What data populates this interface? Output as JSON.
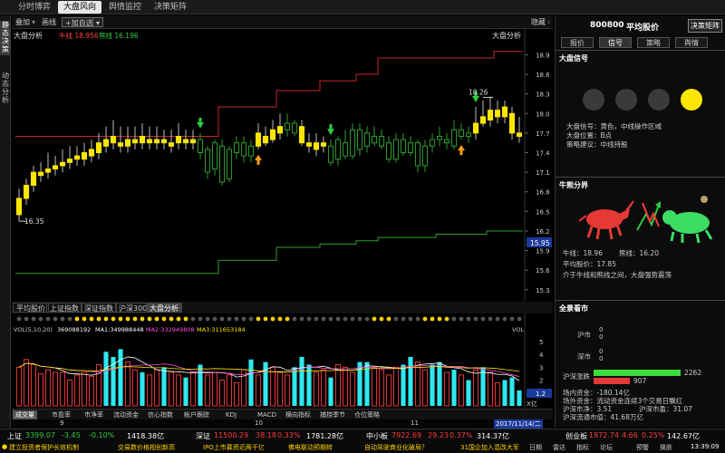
{
  "topnav": {
    "tabs": [
      "分时博弈",
      "大盘风向",
      "舆情监控",
      "决策矩阵"
    ],
    "active": 1
  },
  "leftbar": {
    "items": [
      "静态决策",
      "动态分析"
    ]
  },
  "toolbar": {
    "overlay": "叠加",
    "curve": "画线",
    "add": "+加自选"
  },
  "chart": {
    "label_left": "大盘分析",
    "bull_label": "牛线 18.956",
    "bear_label": "熊线 16.196",
    "label_right": "大盘分析",
    "y_ticks": [
      "18.9",
      "18.6",
      "18.3",
      "18.0",
      "17.7",
      "17.4",
      "17.1",
      "16.8",
      "16.5",
      "16.2",
      "15.9",
      "15.6",
      "15.3"
    ],
    "current_price_tag": "15.95",
    "high_annot": "18.26",
    "low_annot": "16.35",
    "colors": {
      "bull_line": "#c62828",
      "bear_line": "#2e9e2e",
      "up_candle": "#ffe600",
      "down_candle": "#2e9e2e"
    }
  },
  "chart_data": {
    "type": "candlestick",
    "ylim": [
      15.2,
      19.1
    ],
    "candles": [
      {
        "o": 16.45,
        "c": 16.7,
        "h": 16.85,
        "l": 16.35,
        "up": true
      },
      {
        "o": 16.7,
        "c": 16.9,
        "h": 17.0,
        "l": 16.6,
        "up": true
      },
      {
        "o": 16.9,
        "c": 17.1,
        "h": 17.2,
        "l": 16.8,
        "up": true
      },
      {
        "o": 17.05,
        "c": 17.1,
        "h": 17.25,
        "l": 16.95,
        "up": true
      },
      {
        "o": 17.1,
        "c": 17.15,
        "h": 17.4,
        "l": 17.0,
        "up": true
      },
      {
        "o": 17.15,
        "c": 17.2,
        "h": 17.35,
        "l": 17.05,
        "up": true
      },
      {
        "o": 17.2,
        "c": 17.25,
        "h": 17.45,
        "l": 17.1,
        "up": true
      },
      {
        "o": 17.25,
        "c": 17.3,
        "h": 17.5,
        "l": 17.15,
        "up": true
      },
      {
        "o": 17.3,
        "c": 17.35,
        "h": 17.5,
        "l": 17.2,
        "up": true
      },
      {
        "o": 17.3,
        "c": 17.4,
        "h": 17.55,
        "l": 17.2,
        "up": true
      },
      {
        "o": 17.35,
        "c": 17.45,
        "h": 17.6,
        "l": 17.25,
        "up": true
      },
      {
        "o": 17.4,
        "c": 17.55,
        "h": 17.7,
        "l": 17.3,
        "up": true
      },
      {
        "o": 17.5,
        "c": 17.6,
        "h": 17.8,
        "l": 17.4,
        "up": true
      },
      {
        "o": 17.55,
        "c": 17.65,
        "h": 17.9,
        "l": 17.45,
        "up": true
      },
      {
        "o": 17.55,
        "c": 17.5,
        "h": 17.8,
        "l": 17.4,
        "up": true
      },
      {
        "o": 17.5,
        "c": 17.6,
        "h": 17.8,
        "l": 17.4,
        "up": true
      },
      {
        "o": 17.6,
        "c": 17.55,
        "h": 17.8,
        "l": 17.45,
        "up": true
      },
      {
        "o": 17.55,
        "c": 17.65,
        "h": 17.85,
        "l": 17.45,
        "up": true
      },
      {
        "o": 17.6,
        "c": 17.55,
        "h": 17.8,
        "l": 17.45,
        "up": true
      },
      {
        "o": 17.55,
        "c": 17.6,
        "h": 17.8,
        "l": 17.45,
        "up": true
      },
      {
        "o": 17.55,
        "c": 17.6,
        "h": 17.75,
        "l": 17.45,
        "up": true
      },
      {
        "o": 17.5,
        "c": 17.55,
        "h": 17.75,
        "l": 17.4,
        "up": true
      },
      {
        "o": 17.55,
        "c": 17.65,
        "h": 17.85,
        "l": 17.45,
        "up": true
      },
      {
        "o": 17.6,
        "c": 17.55,
        "h": 17.75,
        "l": 17.45,
        "up": true
      },
      {
        "o": 17.55,
        "c": 17.6,
        "h": 17.75,
        "l": 17.45,
        "up": true
      },
      {
        "o": 17.6,
        "c": 17.4,
        "h": 17.7,
        "l": 17.3,
        "up": false
      },
      {
        "o": 17.45,
        "c": 17.1,
        "h": 17.5,
        "l": 17.0,
        "up": false
      },
      {
        "o": 17.15,
        "c": 17.55,
        "h": 17.6,
        "l": 17.05,
        "up": false
      },
      {
        "o": 17.5,
        "c": 16.95,
        "h": 17.6,
        "l": 16.9,
        "up": false
      },
      {
        "o": 17.0,
        "c": 17.45,
        "h": 17.5,
        "l": 16.95,
        "up": false
      },
      {
        "o": 17.4,
        "c": 17.55,
        "h": 17.65,
        "l": 17.3,
        "up": false
      },
      {
        "o": 17.55,
        "c": 17.35,
        "h": 17.65,
        "l": 17.25,
        "up": false
      },
      {
        "o": 17.35,
        "c": 17.5,
        "h": 17.6,
        "l": 17.25,
        "up": false
      },
      {
        "o": 17.5,
        "c": 17.7,
        "h": 17.85,
        "l": 17.45,
        "up": true
      },
      {
        "o": 17.65,
        "c": 17.55,
        "h": 17.8,
        "l": 17.5,
        "up": true
      },
      {
        "o": 17.6,
        "c": 17.75,
        "h": 17.9,
        "l": 17.55,
        "up": true
      },
      {
        "o": 17.7,
        "c": 17.8,
        "h": 18.0,
        "l": 17.6,
        "up": true
      },
      {
        "o": 17.75,
        "c": 17.85,
        "h": 18.0,
        "l": 17.65,
        "up": false
      },
      {
        "o": 17.85,
        "c": 17.7,
        "h": 17.9,
        "l": 17.65,
        "up": false
      },
      {
        "o": 17.8,
        "c": 17.55,
        "h": 17.9,
        "l": 17.5,
        "up": true
      },
      {
        "o": 17.55,
        "c": 17.5,
        "h": 17.7,
        "l": 17.4,
        "up": true
      },
      {
        "o": 17.55,
        "c": 17.45,
        "h": 17.7,
        "l": 17.35,
        "up": true
      },
      {
        "o": 17.5,
        "c": 17.55,
        "h": 17.65,
        "l": 17.4,
        "up": true
      },
      {
        "o": 17.5,
        "c": 17.25,
        "h": 17.6,
        "l": 17.2,
        "up": false
      },
      {
        "o": 17.3,
        "c": 17.6,
        "h": 17.65,
        "l": 17.2,
        "up": false
      },
      {
        "o": 17.55,
        "c": 17.35,
        "h": 17.75,
        "l": 17.3,
        "up": false
      },
      {
        "o": 17.35,
        "c": 17.75,
        "h": 17.85,
        "l": 17.3,
        "up": false
      },
      {
        "o": 17.75,
        "c": 17.45,
        "h": 17.85,
        "l": 17.35,
        "up": false
      },
      {
        "o": 17.5,
        "c": 17.7,
        "h": 17.8,
        "l": 17.4,
        "up": false
      },
      {
        "o": 17.65,
        "c": 17.55,
        "h": 17.8,
        "l": 17.5,
        "up": false
      },
      {
        "o": 17.5,
        "c": 17.65,
        "h": 17.75,
        "l": 17.45,
        "up": false
      },
      {
        "o": 17.55,
        "c": 17.3,
        "h": 17.65,
        "l": 17.25,
        "up": false
      },
      {
        "o": 17.3,
        "c": 17.6,
        "h": 17.7,
        "l": 17.25,
        "up": false
      },
      {
        "o": 17.6,
        "c": 17.4,
        "h": 17.7,
        "l": 17.35,
        "up": false
      },
      {
        "o": 17.4,
        "c": 17.55,
        "h": 17.65,
        "l": 17.35,
        "up": false
      },
      {
        "o": 17.55,
        "c": 17.2,
        "h": 17.6,
        "l": 17.1,
        "up": false
      },
      {
        "o": 17.2,
        "c": 17.5,
        "h": 17.6,
        "l": 17.1,
        "up": false
      },
      {
        "o": 17.5,
        "c": 17.6,
        "h": 17.7,
        "l": 17.4,
        "up": false
      },
      {
        "o": 17.6,
        "c": 17.65,
        "h": 17.8,
        "l": 17.5,
        "up": false
      },
      {
        "o": 17.6,
        "c": 17.55,
        "h": 17.7,
        "l": 17.45,
        "up": false
      },
      {
        "o": 17.5,
        "c": 17.75,
        "h": 17.9,
        "l": 17.45,
        "up": false
      },
      {
        "o": 17.75,
        "c": 17.65,
        "h": 17.85,
        "l": 17.6,
        "up": false
      },
      {
        "o": 17.65,
        "c": 17.7,
        "h": 17.8,
        "l": 17.55,
        "up": false
      },
      {
        "o": 17.7,
        "c": 17.85,
        "h": 18.1,
        "l": 17.6,
        "up": true
      },
      {
        "o": 17.85,
        "c": 17.95,
        "h": 18.2,
        "l": 17.8,
        "up": true
      },
      {
        "o": 17.9,
        "c": 18.05,
        "h": 18.26,
        "l": 17.8,
        "up": true
      },
      {
        "o": 18.05,
        "c": 17.95,
        "h": 18.2,
        "l": 17.85,
        "up": true
      },
      {
        "o": 17.95,
        "c": 18.1,
        "h": 18.2,
        "l": 17.85,
        "up": true
      },
      {
        "o": 18.0,
        "c": 17.7,
        "h": 18.1,
        "l": 17.6,
        "up": true
      },
      {
        "o": 17.7,
        "c": 17.65,
        "h": 17.95,
        "l": 17.55,
        "up": true
      }
    ],
    "bull_line": [
      17.65,
      17.65,
      17.65,
      17.65,
      17.65,
      17.65,
      17.65,
      17.65,
      17.65,
      17.65,
      17.65,
      17.65,
      17.65,
      17.65,
      17.65,
      17.65,
      17.65,
      17.65,
      17.65,
      17.65,
      17.65,
      17.65,
      17.65,
      17.65,
      17.65,
      17.65,
      17.65,
      17.65,
      18.1,
      18.1,
      18.1,
      18.1,
      18.1,
      18.1,
      18.1,
      18.1,
      18.35,
      18.35,
      18.35,
      18.35,
      18.35,
      18.35,
      18.5,
      18.5,
      18.5,
      18.5,
      18.5,
      18.6,
      18.6,
      18.6,
      18.85,
      18.85,
      18.85,
      18.85,
      18.85,
      18.85,
      18.85,
      18.85,
      18.85,
      18.85,
      18.85,
      18.85,
      18.85,
      18.85,
      18.85,
      18.85,
      18.95,
      18.95,
      18.95,
      18.95
    ],
    "bear_line": [
      15.55,
      15.55,
      15.55,
      15.55,
      15.55,
      15.55,
      15.55,
      15.55,
      15.55,
      15.55,
      15.55,
      15.55,
      15.55,
      15.55,
      15.55,
      15.55,
      15.55,
      15.55,
      15.55,
      15.55,
      15.55,
      15.55,
      15.55,
      15.55,
      15.55,
      15.55,
      15.55,
      15.55,
      15.75,
      15.75,
      15.75,
      15.75,
      15.75,
      15.75,
      15.75,
      15.75,
      15.95,
      15.95,
      15.95,
      15.95,
      15.95,
      15.95,
      16.0,
      16.0,
      16.0,
      16.0,
      16.0,
      16.05,
      16.05,
      16.05,
      16.1,
      16.1,
      16.1,
      16.1,
      16.1,
      16.1,
      16.1,
      16.1,
      16.15,
      16.15,
      16.15,
      16.15,
      16.15,
      16.15,
      16.15,
      16.2,
      16.2,
      16.2,
      16.2,
      16.2
    ],
    "signals": [
      {
        "i": 25,
        "type": "down"
      },
      {
        "i": 33,
        "type": "up"
      },
      {
        "i": 43,
        "type": "down"
      },
      {
        "i": 61,
        "type": "up"
      },
      {
        "i": 63,
        "type": "down"
      }
    ]
  },
  "subtabs": [
    "平均股价",
    "上证指数",
    "深证指数",
    "沪深300",
    "大盘分析"
  ],
  "subtab_active": 4,
  "vol": {
    "label": "VOL(5,10,20)",
    "val": "369088192",
    "ma1": "MA1:349988448",
    "ma2": "MA2:332949808",
    "ma3": "MA3:311653184",
    "right_label": "VOL",
    "y_ticks": [
      "5",
      "4",
      "3",
      "2",
      "1"
    ],
    "unit": "X亿",
    "current_tag": "1.2",
    "values": [
      3.0,
      3.6,
      3.2,
      2.5,
      2.8,
      2.6,
      2.6,
      2.0,
      2.4,
      2.6,
      2.3,
      3.2,
      4.2,
      3.8,
      4.4,
      3.4,
      2.8,
      2.6,
      2.4,
      2.8,
      3.0,
      2.6,
      2.4,
      2.2,
      2.6,
      3.2,
      2.4,
      2.6,
      2.0,
      2.4,
      1.8,
      2.8,
      3.6,
      2.4,
      3.4,
      3.0,
      2.6,
      2.4,
      3.0,
      3.8,
      3.2,
      2.6,
      2.8,
      2.2,
      3.2,
      3.0,
      2.6,
      3.4,
      3.4,
      3.0,
      2.8,
      2.4,
      3.0,
      3.2,
      3.8,
      3.4,
      2.8,
      3.2,
      3.4,
      2.6,
      2.8,
      2.4,
      2.0,
      2.8,
      3.0,
      2.6,
      1.8,
      2.0,
      2.2,
      1.2
    ],
    "cyan_idx": [
      12,
      13,
      14,
      17,
      20,
      23,
      25,
      32,
      34,
      38,
      39,
      40,
      43,
      47,
      48,
      53,
      54,
      57,
      58,
      60,
      62,
      64,
      67,
      68,
      69
    ],
    "dots_yellow": [
      8,
      9,
      10,
      11,
      12,
      13,
      14,
      15,
      16,
      17,
      18,
      19,
      20,
      21,
      22,
      23,
      33,
      34,
      35,
      36,
      37,
      49,
      50,
      51,
      56,
      57,
      58,
      59
    ]
  },
  "bottomtabs": [
    "成交量",
    "市盈率",
    "市净率",
    "流动资金",
    "信心指数",
    "帐户跟踪",
    "KDJ",
    "MACD",
    "横向指标",
    "捕捞季节",
    "仓位策略"
  ],
  "bottomtab_active": 0,
  "dates": {
    "d1": "9",
    "d2": "10",
    "d3": "11",
    "current": "2017/11/14/二"
  },
  "right": {
    "code": "800800",
    "name": "平均股价",
    "decision_btn": "决策矩阵",
    "tabs": [
      "报价",
      "信号",
      "策略",
      "舆情"
    ],
    "tab_active": 1,
    "signal_title": "大盘信号",
    "signal_lines": [
      "大盘信号：黄色，中线操作区域",
      "大盘位置：B点",
      "策略建议：中线持股"
    ],
    "bullbear_title": "牛熊分界",
    "bull_text": "牛线：18.96",
    "bear_text": "熊线：16.20",
    "avg_text": "平均股价：17.85",
    "between_text": "介于牛线和熊线之间，大盘强势震荡",
    "market_title": "全景看市",
    "sh_label": "沪市",
    "sh_values": [
      "0",
      "0"
    ],
    "sz_label": "深市",
    "sz_values": [
      "0",
      "0"
    ],
    "hs_label": "沪深涨跌",
    "up_count": "2262",
    "down_count": "907",
    "fund_lines": [
      "场内资金：-180.14亿",
      "场外资金：流动资金连续3个交易日飘红",
      "沪深市净：3.51",
      "沪深市盈：31.07",
      "沪深流通市值：41.68万亿"
    ]
  },
  "statusbar": {
    "sh_label": "上证",
    "sh_val": "3399.07",
    "sh_chg": "-3.45",
    "sh_pct": "-0.10%",
    "sh_amt": "1418.38亿",
    "sz_label": "深证",
    "sz_val": "11500.29",
    "sz_chg": "38.18",
    "sz_pct": "0.33%",
    "sz_amt": "1781.28亿",
    "zx_label": "中小板",
    "zx_val": "7922.69",
    "zx_chg": "29.23",
    "zx_pct": "0.37%",
    "zx_amt": "314.37亿",
    "cy_label": "创业板",
    "cy_val": "1872.74",
    "cy_chg": "4.66",
    "cy_pct": "0.25%",
    "cy_amt": "142.67亿",
    "news": [
      "建立投资者保护长效机制",
      "交易数价格相创新高",
      "IPO上市募资近两千亿",
      "佛电联动预期转",
      "自动驾驶商业化破局？",
      "31国企加入混改大军"
    ],
    "icons": [
      "日期",
      "指标",
      "论坛",
      "预警",
      "雷达",
      "换肤"
    ],
    "time": "13:39:09",
    "zoom_label": "1"
  }
}
